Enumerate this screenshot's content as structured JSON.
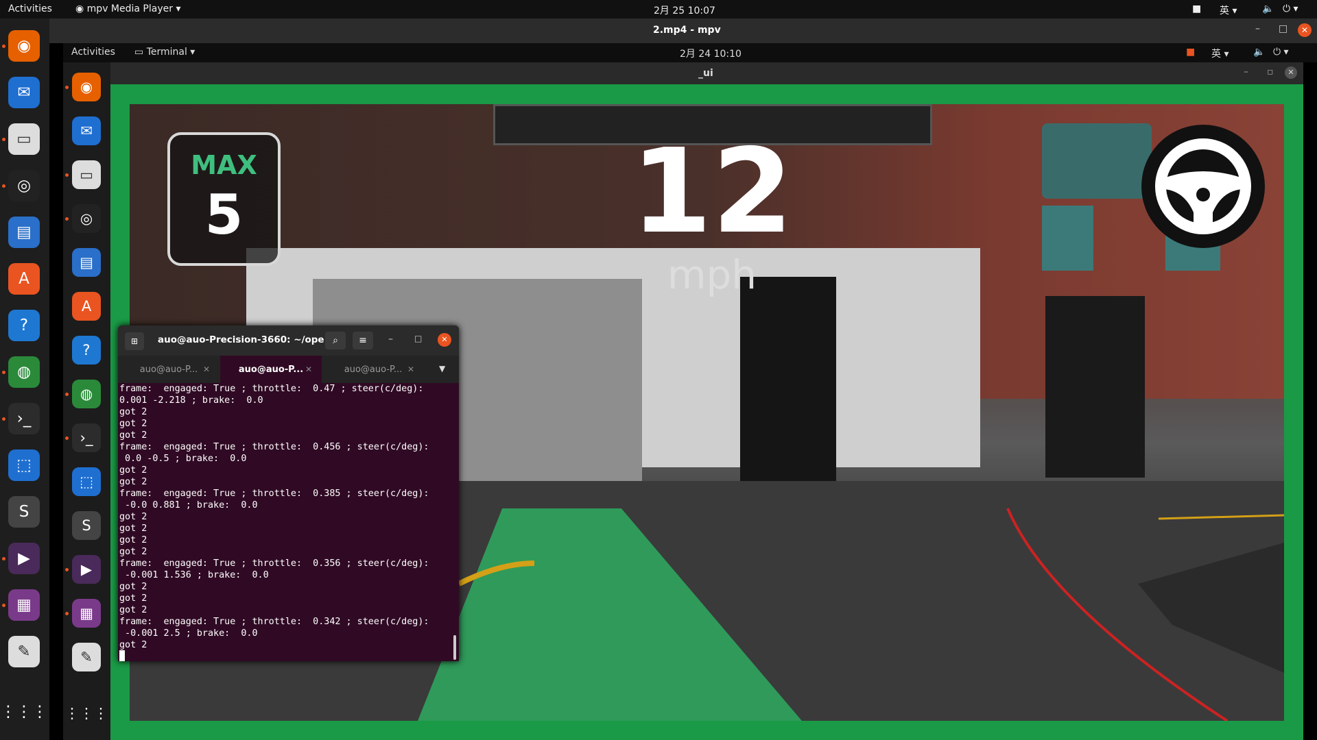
{
  "topbar": {
    "activities": "Activities",
    "app_menu": "mpv Media Player",
    "clock": "2月 25  10:07",
    "lang": "英"
  },
  "mpv": {
    "title": "2.mp4 - mpv"
  },
  "inner_topbar": {
    "activities": "Activities",
    "app_menu": "Terminal",
    "clock": "2月 24  10:10",
    "lang": "英"
  },
  "ui_window": {
    "title": "_ui"
  },
  "hud": {
    "max_label": "MAX",
    "max_value": "5",
    "speed": "12",
    "unit": "mph"
  },
  "terminal": {
    "title": "auo@auo-Precision-3660: ~/ope...",
    "tabs": [
      "auo@auo-P...",
      "auo@auo-P...",
      "auo@auo-P..."
    ],
    "lines": [
      "frame:  engaged: True ; throttle:  0.47 ; steer(c/deg):",
      "0.001 -2.218 ; brake:  0.0",
      "got 2",
      "got 2",
      "got 2",
      "frame:  engaged: True ; throttle:  0.456 ; steer(c/deg):",
      " 0.0 -0.5 ; brake:  0.0",
      "got 2",
      "got 2",
      "frame:  engaged: True ; throttle:  0.385 ; steer(c/deg):",
      " -0.0 0.881 ; brake:  0.0",
      "got 2",
      "got 2",
      "got 2",
      "got 2",
      "frame:  engaged: True ; throttle:  0.356 ; steer(c/deg):",
      " -0.001 1.536 ; brake:  0.0",
      "got 2",
      "got 2",
      "got 2",
      "frame:  engaged: True ; throttle:  0.342 ; steer(c/deg):",
      " -0.001 2.5 ; brake:  0.0",
      "got 2"
    ]
  },
  "dock_apps": [
    "firefox-icon",
    "thunderbird-icon",
    "files-icon",
    "rhythmbox-icon",
    "writer-icon",
    "software-icon",
    "help-icon",
    "chrome-icon",
    "terminal-icon",
    "screenshot-icon",
    "sublime-icon",
    "mpv-icon",
    "video-icon",
    "text-editor-icon",
    "app-grid-icon"
  ],
  "colors": {
    "accent": "#e95420",
    "frame_green": "#1a9a46",
    "terminal_bg": "#300a24",
    "hud_green": "#3fbf7f"
  }
}
